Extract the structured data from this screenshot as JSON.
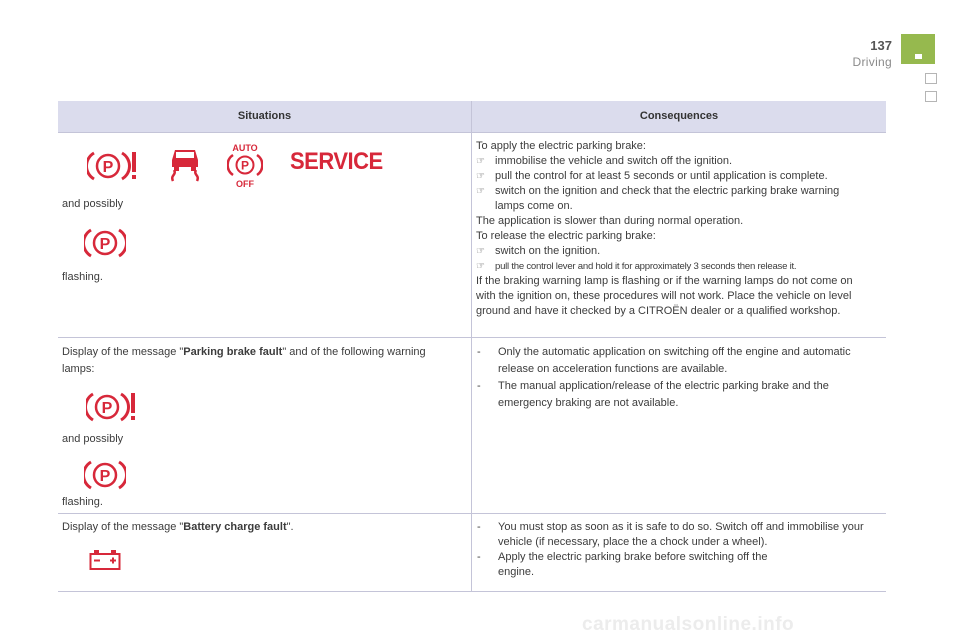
{
  "header": {
    "page_number": "137",
    "section": "Driving"
  },
  "table": {
    "col_situations": "Situations",
    "col_consequences": "Consequences",
    "row1": {
      "and_possibly": "and possibly",
      "flashing": "flashing.",
      "service_label": "SERVICE",
      "auto_label": "AUTO",
      "off_label": "OFF",
      "icons": [
        "parking-brake-exclamation-icon",
        "skid-car-icon",
        "auto-parking-off-icon",
        "service-icon",
        "parking-brake-p-icon"
      ],
      "c1": "To apply the electric parking brake:",
      "b1": "immobilise the vehicle and switch off the ignition.",
      "b2": "pull the control for at least 5 seconds or until application is complete.",
      "b3": "switch on the ignition and check that the electric parking brake warning lamps come on.",
      "c2": "The application is slower than during normal operation.",
      "c3": "To release the electric parking brake:",
      "b4": "switch on the ignition.",
      "b5": "pull the control lever and hold it for approximately 3 seconds then release it.",
      "c4": "If the braking warning lamp is flashing or if the warning lamps do not come on with the ignition on, these procedures will not work. Place the vehicle on level ground and have it checked by a CITROËN dealer or a qualified workshop."
    },
    "row2": {
      "s_pre": "Display of the message \"",
      "s_bold": "Parking brake fault",
      "s_post": "\" and of the following warning lamps:",
      "and_possibly": "and possibly",
      "flashing": "flashing.",
      "d1": "Only the automatic application on switching off the engine and automatic release on acceleration functions are available.",
      "d2": "The manual application/release of the electric parking brake and the emergency braking are not available."
    },
    "row3": {
      "s_pre": "Display of the message \"",
      "s_bold": "Battery charge fault",
      "s_post": "\".",
      "icons": [
        "battery-icon"
      ],
      "d1": "You must stop as soon as it is safe to do so. Switch off and immobilise your vehicle (if necessary, place the a chock under a wheel).",
      "d2": "Apply the electric parking brake before switching off the engine."
    }
  },
  "colors": {
    "warning_red": "#d7283a",
    "header_bg": "#dbdced",
    "tab_green": "#96b94e"
  },
  "watermark": "carmanualsonline.info"
}
